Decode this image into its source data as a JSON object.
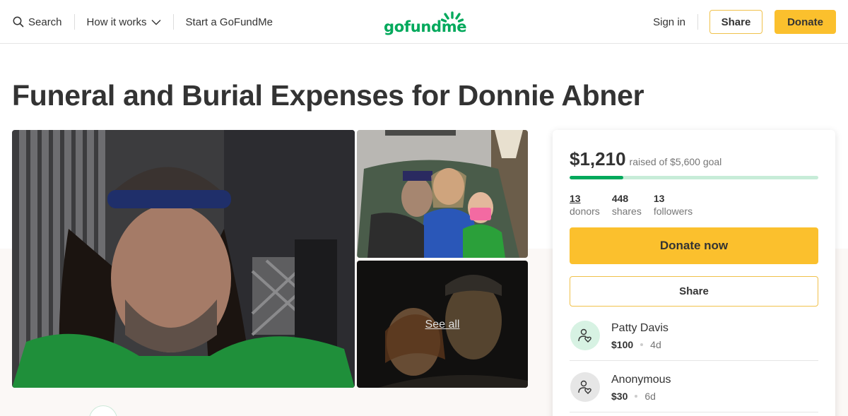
{
  "header": {
    "search_label": "Search",
    "how_it_works_label": "How it works",
    "start_label": "Start a GoFundMe",
    "logo_text": "gofundme",
    "sign_in_label": "Sign in",
    "share_label": "Share",
    "donate_label": "Donate"
  },
  "campaign": {
    "title": "Funeral and Burial Expenses for Donnie Abner",
    "see_all_label": "See all"
  },
  "summary": {
    "raised_amount": "$1,210",
    "raised_goal_text": "raised of $5,600 goal",
    "progress_fraction": 0.216,
    "stats": [
      {
        "value": "13",
        "label": "donors"
      },
      {
        "value": "448",
        "label": "shares"
      },
      {
        "value": "13",
        "label": "followers"
      }
    ],
    "donate_now_label": "Donate now",
    "share_label": "Share"
  },
  "donations": [
    {
      "name": "Patty Davis",
      "amount": "$100",
      "time": "4d"
    },
    {
      "name": "Anonymous",
      "amount": "$30",
      "time": "6d"
    }
  ],
  "colors": {
    "brand_green": "#02a95c",
    "donate_yellow": "#fbc02d",
    "progress_track": "#c7ecd8"
  }
}
